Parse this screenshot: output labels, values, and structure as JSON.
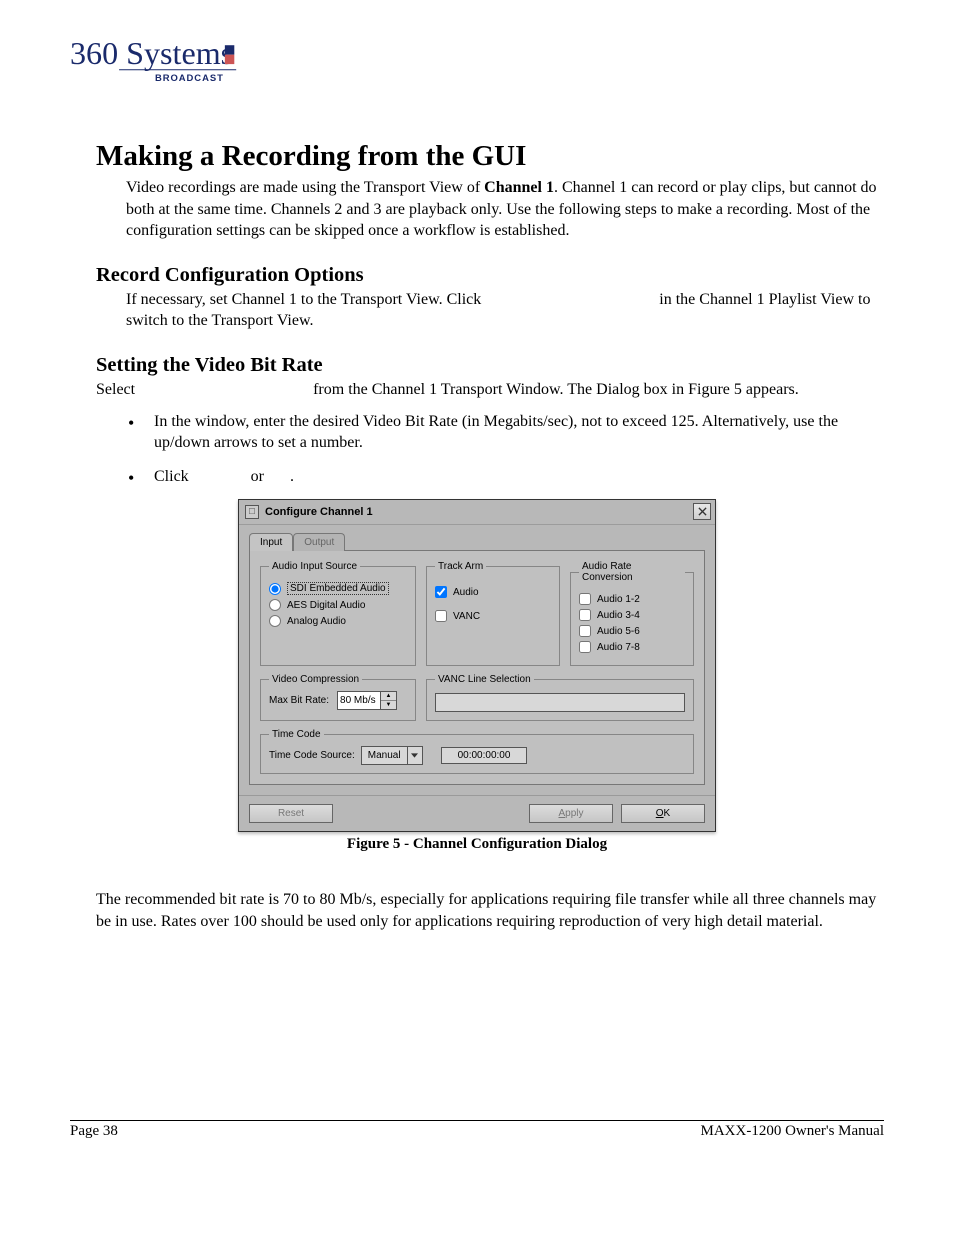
{
  "logo": {
    "script": "360 Systems",
    "brand": "BROADCAST"
  },
  "h1": "Making a Recording from the GUI",
  "p1a": "Video recordings are made using the Transport View of ",
  "p1b": "Channel 1",
  "p1c": ".  Channel 1 can record or play clips, but cannot do both at the same time. Channels 2 and 3 are playback only. Use the following steps to make a recording. Most of the configuration settings can be skipped once a workflow is established.",
  "h2a": "Record Configuration Options",
  "p2a": "If necessary, set Channel 1 to the Transport View. Click ",
  "p2b": " in the Channel 1 Playlist View to switch to the Transport View.",
  "h2b": "Setting the Video Bit Rate",
  "p3a": "Select ",
  "p3b": " from the Channel 1 Transport Window. The Dialog box in Figure 5 appears.",
  "bul1": "In the window, enter the desired Video Bit Rate (in Megabits/sec), not to exceed 125. Alternatively, use the up/down arrows to set a number.",
  "bul2a": "Click ",
  "bul2b": " or ",
  "bul2c": " .",
  "dialog": {
    "title": "Configure Channel 1",
    "tabs": {
      "input": "Input",
      "output": "Output"
    },
    "groups": {
      "audio_input_source": "Audio Input Source",
      "track_arm": "Track Arm",
      "audio_rate_conversion": "Audio Rate Conversion",
      "video_compression": "Video Compression",
      "vanc_line_selection": "VANC Line Selection",
      "time_code": "Time Code"
    },
    "radios": {
      "sdi": "SDI Embedded Audio",
      "aes": "AES Digital Audio",
      "analog": "Analog Audio"
    },
    "trackarm": {
      "audio": "Audio",
      "vanc": "VANC"
    },
    "rateconv": {
      "a12": "Audio 1-2",
      "a34": "Audio 3-4",
      "a56": "Audio 5-6",
      "a78": "Audio 7-8"
    },
    "maxbitrate_label": "Max Bit Rate:",
    "maxbitrate_value": "80 Mb/s",
    "timecode_source_label": "Time Code Source:",
    "timecode_source_value": "Manual",
    "timecode_value": "00:00:00:00",
    "buttons": {
      "reset": "Reset",
      "apply_prefix": "A",
      "apply_rest": "pply",
      "ok_prefix": "O",
      "ok_rest": "K"
    }
  },
  "figure_caption": "Figure 5 - Channel Configuration Dialog",
  "post": "The recommended bit rate is 70 to 80 Mb/s, especially for applications requiring file transfer while all three channels may be in use. Rates over 100 should be used only for applications requiring reproduction of very high detail material.",
  "footer": {
    "page": "Page 38",
    "manual": "MAXX-1200 Owner's Manual"
  }
}
